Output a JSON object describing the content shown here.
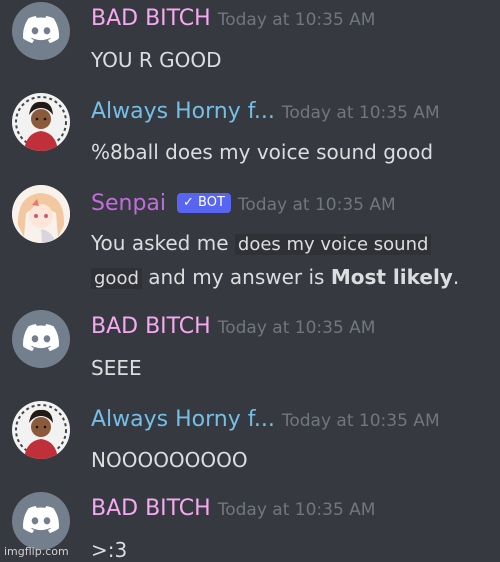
{
  "colors": {
    "background": "#36393f",
    "bad_bitch_name": "#f6a9f2",
    "always_horny_name": "#74bfe8",
    "senpai_name": "#c26ddc",
    "timestamp": "#72767d",
    "message_text": "#dcddde",
    "bot_tag": "#5865f2"
  },
  "messages": [
    {
      "avatar": "discord-logo",
      "username": "BAD BITCH",
      "timestamp": "Today at 10:35 AM",
      "text": "YOU R GOOD"
    },
    {
      "avatar": "user-avatar",
      "username": "Always Horny f...",
      "timestamp": "Today at 10:35 AM",
      "text": "%8ball does my voice sound good"
    },
    {
      "avatar": "bot-avatar",
      "username": "Senpai",
      "bot_tag": "✓ BOT",
      "timestamp": "Today at 10:35 AM",
      "text_prefix": "You asked me ",
      "quote_part1": "does my voice sound",
      "quote_part2": "good",
      "text_mid": " and my answer is ",
      "answer": "Most likely",
      "text_suffix": "."
    },
    {
      "avatar": "discord-logo",
      "username": "BAD BITCH",
      "timestamp": "Today at 10:35 AM",
      "text": "SEEE"
    },
    {
      "avatar": "user-avatar",
      "username": "Always Horny f...",
      "timestamp": "Today at 10:35 AM",
      "text": "NOOOOOOOOO"
    },
    {
      "avatar": "discord-logo",
      "username": "BAD BITCH",
      "timestamp": "Today at 10:35 AM",
      "text": ">:3"
    }
  ],
  "watermark": "imgflip.com"
}
